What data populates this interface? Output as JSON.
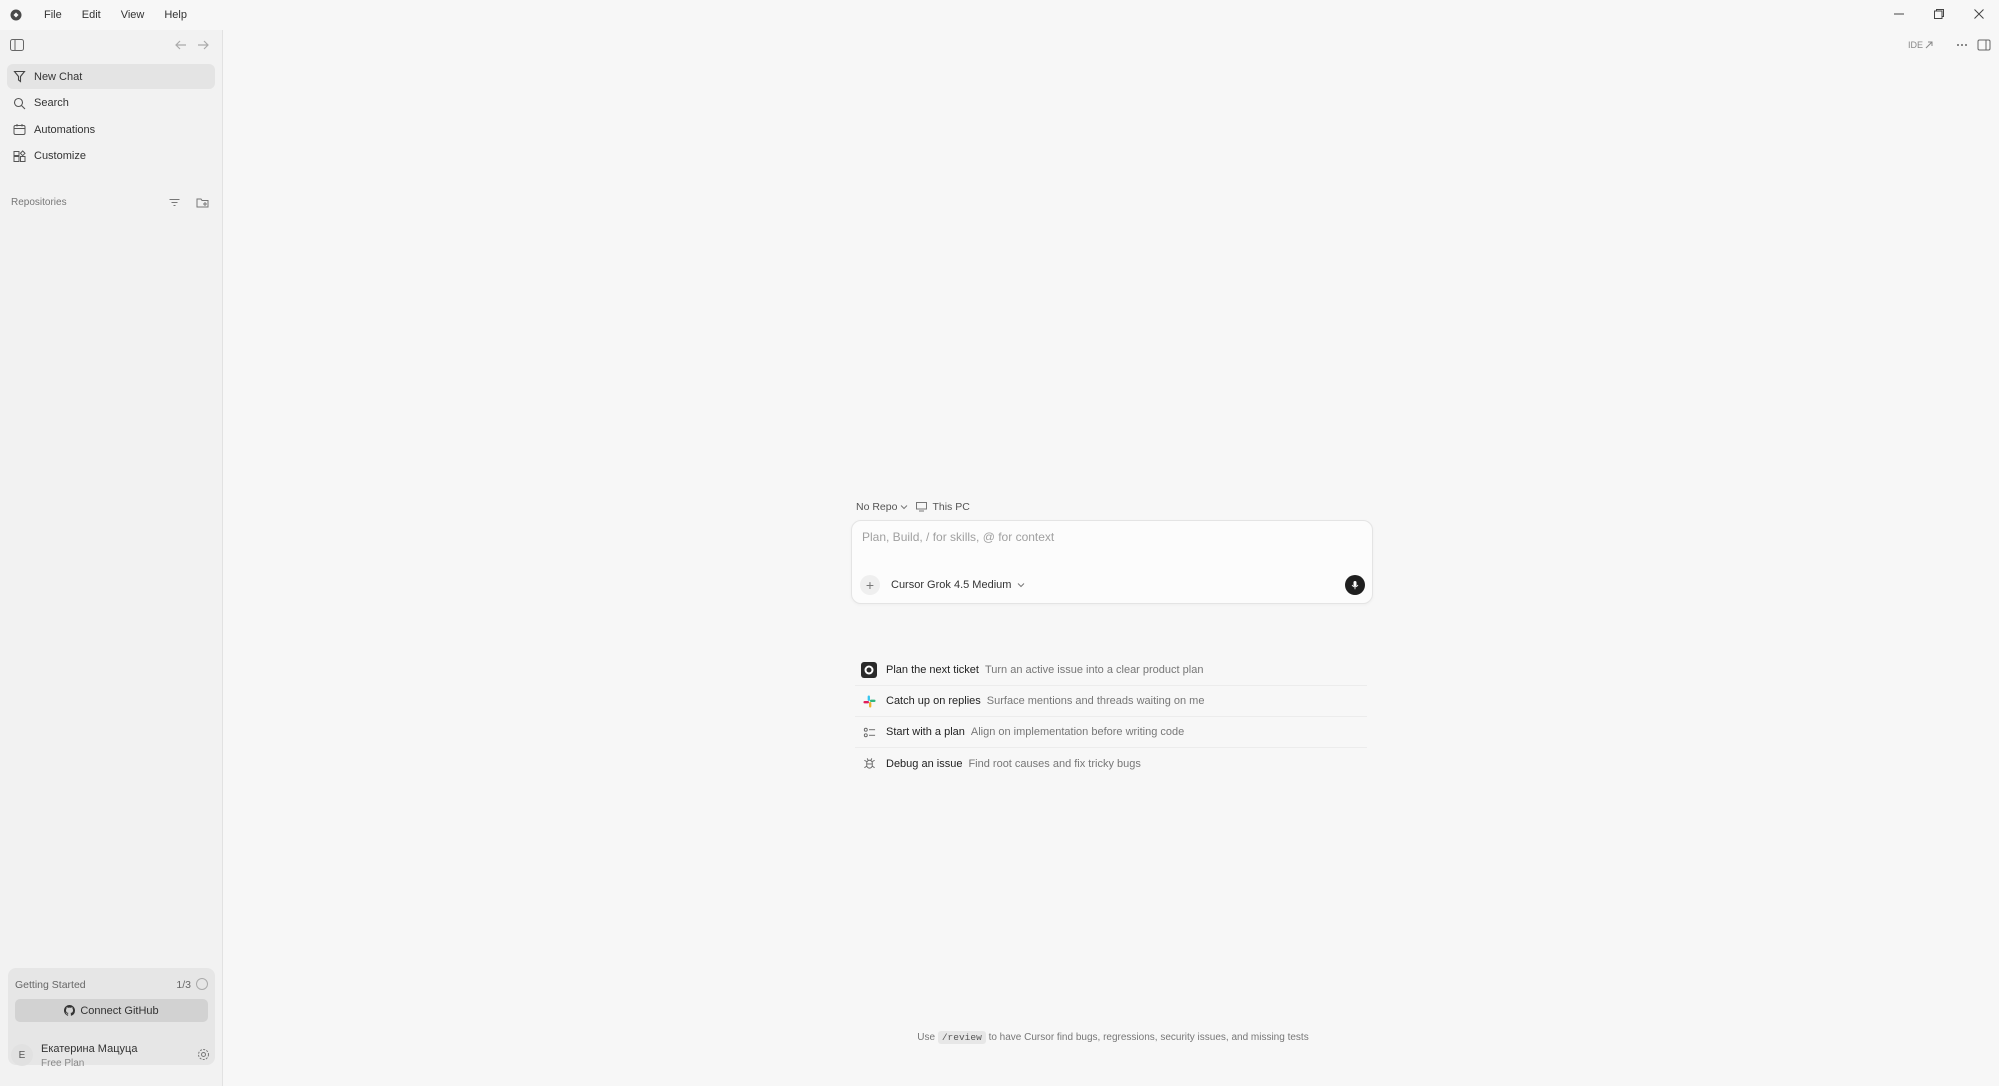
{
  "menubar": {
    "items": [
      "File",
      "Edit",
      "View",
      "Help"
    ]
  },
  "sidebar": {
    "nav": [
      {
        "label": "New Chat",
        "icon": "new-chat-icon"
      },
      {
        "label": "Search",
        "icon": "search-icon"
      },
      {
        "label": "Automations",
        "icon": "automations-icon"
      },
      {
        "label": "Customize",
        "icon": "customize-icon"
      }
    ],
    "repositories_label": "Repositories",
    "getting_started": {
      "title": "Getting Started",
      "progress": "1/3",
      "button": "Connect GitHub"
    },
    "user": {
      "initial": "E",
      "name": "Екатерина Мацуца",
      "plan": "Free Plan"
    }
  },
  "topbar": {
    "ide_label": "IDE"
  },
  "composer": {
    "repo": "No Repo",
    "location": "This PC",
    "placeholder": "Plan, Build, / for skills, @ for context",
    "model": "Cursor Grok 4.5 Medium"
  },
  "suggestions": [
    {
      "title": "Plan the next ticket",
      "desc": "Turn an active issue into a clear product plan",
      "icon": "linear-icon"
    },
    {
      "title": "Catch up on replies",
      "desc": "Surface mentions and threads waiting on me",
      "icon": "slack-icon"
    },
    {
      "title": "Start with a plan",
      "desc": "Align on implementation before writing code",
      "icon": "plan-list-icon"
    },
    {
      "title": "Debug an issue",
      "desc": "Find root causes and fix tricky bugs",
      "icon": "bug-icon"
    }
  ],
  "footer": {
    "prefix": "Use",
    "command": "/review",
    "suffix": "to have Cursor find bugs, regressions, security issues, and missing tests"
  }
}
